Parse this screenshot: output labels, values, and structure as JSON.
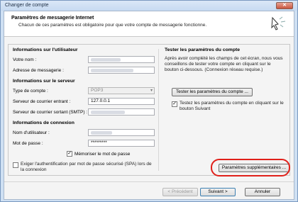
{
  "window": {
    "title": "Changer de compte",
    "close_symbol": "✕"
  },
  "header": {
    "title": "Paramètres de messagerie Internet",
    "subtitle": "Chacun de ces paramètres est obligatoire pour que votre compte de messagerie fonctionne."
  },
  "user_info": {
    "heading": "Informations sur l'utilisateur",
    "name_label": "Votre nom :",
    "email_label": "Adresse de messagerie :"
  },
  "server_info": {
    "heading": "Informations sur le serveur",
    "account_type_label": "Type de compte :",
    "account_type_value": "POP3",
    "incoming_label": "Serveur de courrier entrant :",
    "incoming_value": "127.0.0.1",
    "outgoing_label": "Serveur de courrier sortant (SMTP) :"
  },
  "login_info": {
    "heading": "Informations de connexion",
    "username_label": "Nom d'utilisateur :",
    "password_label": "Mot de passe :",
    "password_value": "*********",
    "remember_label": "Mémoriser le mot de passe",
    "spa_label": "Exiger l'authentification par mot de passe sécurisé (SPA) lors de la connexion"
  },
  "test": {
    "heading": "Tester les paramètres du compte",
    "description": "Après avoir complété les champs de cet écran, nous vous conseillons de tester votre compte en cliquant sur le bouton ci-dessous. (Connexion réseau requise.)",
    "test_button": "Tester les paramètres du compte ...",
    "test_checkbox_label": "Testez les paramètres du compte en cliquant sur le bouton Suivant"
  },
  "more_settings_button": "Paramètres supplémentaires ...",
  "footer": {
    "back": "< Précédent",
    "next": "Suivant >",
    "cancel": "Annuler"
  }
}
